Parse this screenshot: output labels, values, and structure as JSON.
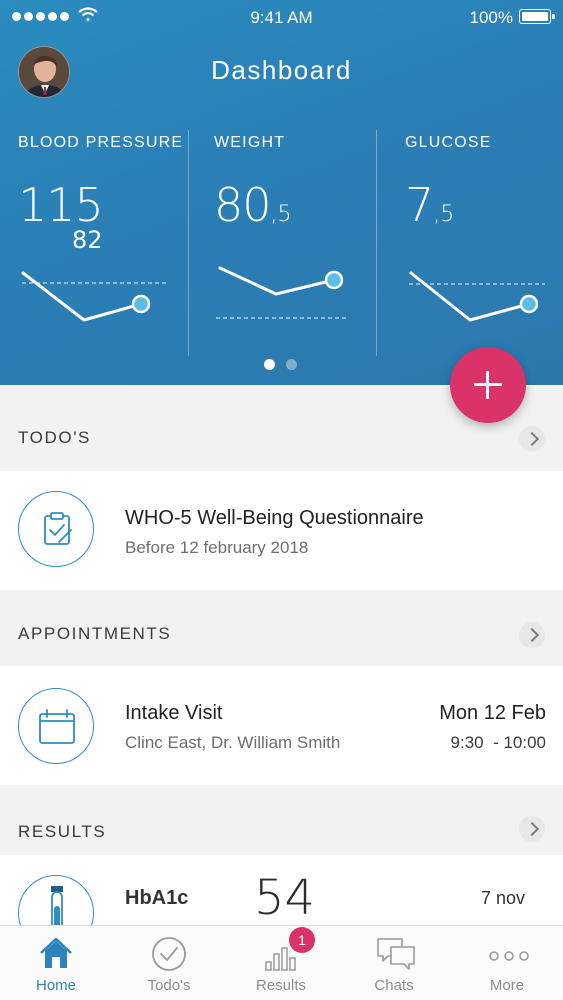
{
  "status_bar": {
    "time": "9:41 AM",
    "battery": "100%"
  },
  "header": {
    "title": "Dashboard"
  },
  "metrics": [
    {
      "label": "BLOOD PRESSURE",
      "value": "115",
      "decimal": "",
      "sub_value": "82"
    },
    {
      "label": "WEIGHT",
      "value": "80",
      "decimal": ",5",
      "sub_value": ""
    },
    {
      "label": "GLUCOSE",
      "value": "7",
      "decimal": ",5",
      "sub_value": ""
    }
  ],
  "pager": {
    "pages": 2,
    "active": 1
  },
  "todos": {
    "section_title": "TODO'S",
    "item": {
      "title": "WHO-5 Well-Being Questionnaire",
      "subtitle": "Before 12 february 2018"
    }
  },
  "appointments": {
    "section_title": "APPOINTMENTS",
    "item": {
      "title": "Intake Visit",
      "subtitle": "Clinc East, Dr. William Smith",
      "date": "Mon 12 Feb",
      "time": "9:30  - 10:00"
    }
  },
  "results": {
    "section_title": "RESULTS",
    "item": {
      "name": "HbA1c",
      "value": "54",
      "date": "7 nov"
    }
  },
  "tabbar": {
    "tabs": [
      {
        "label": "Home",
        "icon": "home-icon",
        "active": true
      },
      {
        "label": "Todo's",
        "icon": "checkmark-circle-icon"
      },
      {
        "label": "Results",
        "icon": "bar-chart-icon",
        "badge": "1"
      },
      {
        "label": "Chats",
        "icon": "chat-bubbles-icon"
      },
      {
        "label": "More",
        "icon": "more-dots-icon"
      }
    ]
  },
  "colors": {
    "header": "#2a85bb",
    "accent": "#d9336a",
    "primary": "#2b84bd"
  }
}
